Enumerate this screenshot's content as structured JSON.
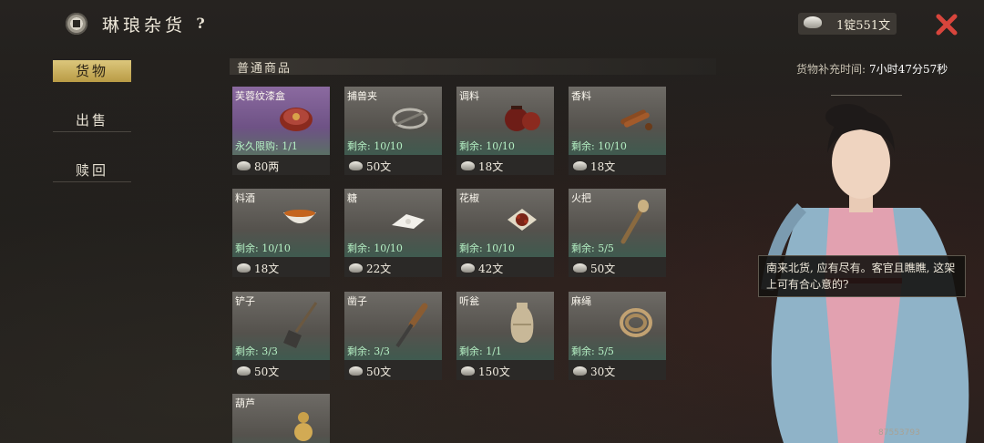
{
  "header": {
    "title": "琳琅杂货",
    "help_label": "?",
    "currency": "1锭551文"
  },
  "nav": [
    {
      "label": "货物",
      "active": true
    },
    {
      "label": "出售",
      "active": false
    },
    {
      "label": "赎回",
      "active": false
    }
  ],
  "restock": {
    "label": "货物补充时间:",
    "time": "7小时47分57秒"
  },
  "section_title": "普通商品",
  "items": [
    {
      "name": "芙蓉纹漆盒",
      "stock": "永久限购: 1/1",
      "price": "80两",
      "icon": "lacquer-box-icon",
      "purple": true
    },
    {
      "name": "捕兽夹",
      "stock": "剩余: 10/10",
      "price": "50文",
      "icon": "trap-icon"
    },
    {
      "name": "调料",
      "stock": "剩余: 10/10",
      "price": "18文",
      "icon": "seasoning-jar-icon"
    },
    {
      "name": "香料",
      "stock": "剩余: 10/10",
      "price": "18文",
      "icon": "spice-icon"
    },
    {
      "name": "料酒",
      "stock": "剩余: 10/10",
      "price": "18文",
      "icon": "wine-bowl-icon"
    },
    {
      "name": "糖",
      "stock": "剩余: 10/10",
      "price": "22文",
      "icon": "sugar-icon"
    },
    {
      "name": "花椒",
      "stock": "剩余: 10/10",
      "price": "42文",
      "icon": "peppercorn-icon"
    },
    {
      "name": "火把",
      "stock": "剩余: 5/5",
      "price": "50文",
      "icon": "torch-icon"
    },
    {
      "name": "铲子",
      "stock": "剩余: 3/3",
      "price": "50文",
      "icon": "shovel-icon"
    },
    {
      "name": "凿子",
      "stock": "剩余: 3/3",
      "price": "50文",
      "icon": "chisel-icon"
    },
    {
      "name": "听瓮",
      "stock": "剩余: 1/1",
      "price": "150文",
      "icon": "urn-icon"
    },
    {
      "name": "麻绳",
      "stock": "剩余: 5/5",
      "price": "30文",
      "icon": "rope-icon"
    },
    {
      "name": "葫芦",
      "stock": "",
      "price": "",
      "icon": "gourd-icon"
    }
  ],
  "merchant": {
    "speech": "南来北货, 应有尽有。客官且瞧瞧, 这架上可有合心意的?"
  },
  "watermark": "87553793"
}
